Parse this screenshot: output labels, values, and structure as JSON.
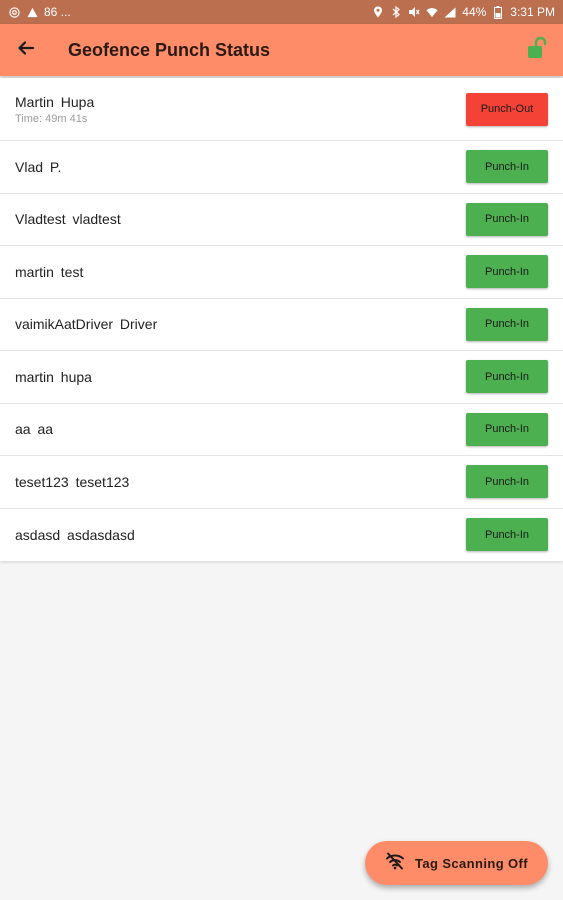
{
  "status_bar": {
    "notification_text": "86 ...",
    "battery": "44%",
    "time": "3:31 PM",
    "color": "#bc6f4f"
  },
  "app_bar": {
    "title": "Geofence Punch Status",
    "back_icon": "arrow-back-icon",
    "lock_icon": "lock-open-icon",
    "color": "#ff8c69",
    "lock_color": "#4caf50"
  },
  "list": [
    {
      "name": "Martin  Hupa",
      "time": "Time: 49m 41s",
      "button": "Punch-Out",
      "state": "out"
    },
    {
      "name": "Vlad  P.",
      "button": "Punch-In",
      "state": "in"
    },
    {
      "name": "Vladtest  vladtest",
      "button": "Punch-In",
      "state": "in"
    },
    {
      "name": "martin  test",
      "button": "Punch-In",
      "state": "in"
    },
    {
      "name": "vaimikAatDriver  Driver",
      "button": "Punch-In",
      "state": "in"
    },
    {
      "name": "martin  hupa",
      "button": "Punch-In",
      "state": "in"
    },
    {
      "name": "aa  aa",
      "button": "Punch-In",
      "state": "in"
    },
    {
      "name": "teset123  teset123",
      "button": "Punch-In",
      "state": "in"
    },
    {
      "name": "asdasd  asdasdasd",
      "button": "Punch-In",
      "state": "in"
    }
  ],
  "colors": {
    "punch_in": "#4caf50",
    "punch_out": "#f44336"
  },
  "fab": {
    "label": "Tag Scanning Off",
    "icon": "wifi-off-icon"
  }
}
